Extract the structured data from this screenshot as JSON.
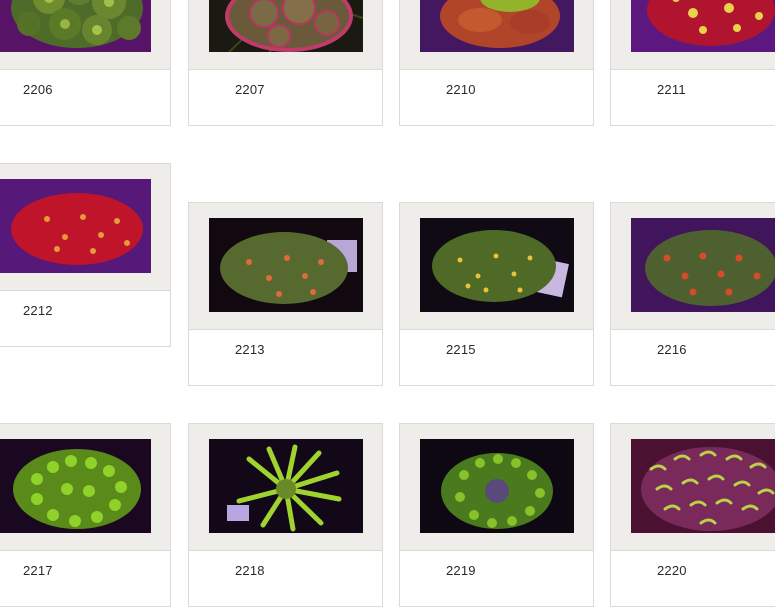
{
  "products": [
    {
      "id": "2206",
      "icon": "coral-mushroom-green-cluster"
    },
    {
      "id": "2207",
      "icon": "coral-mushroom-pink-rim"
    },
    {
      "id": "2210",
      "icon": "coral-mushroom-orange-green"
    },
    {
      "id": "2211",
      "icon": "coral-mushroom-red-yellow-spots"
    },
    {
      "id": "2212",
      "icon": "coral-mushroom-red-spots"
    },
    {
      "id": "2213",
      "icon": "coral-mushroom-green-orange-dots"
    },
    {
      "id": "2215",
      "icon": "coral-mushroom-green-yellow-dots"
    },
    {
      "id": "2216",
      "icon": "coral-mushroom-green-red-dots"
    },
    {
      "id": "2217",
      "icon": "coral-hammer-green"
    },
    {
      "id": "2218",
      "icon": "coral-hammer-lime"
    },
    {
      "id": "2219",
      "icon": "coral-hammer-green-dark"
    },
    {
      "id": "2220",
      "icon": "coral-branching-pink-green"
    }
  ]
}
